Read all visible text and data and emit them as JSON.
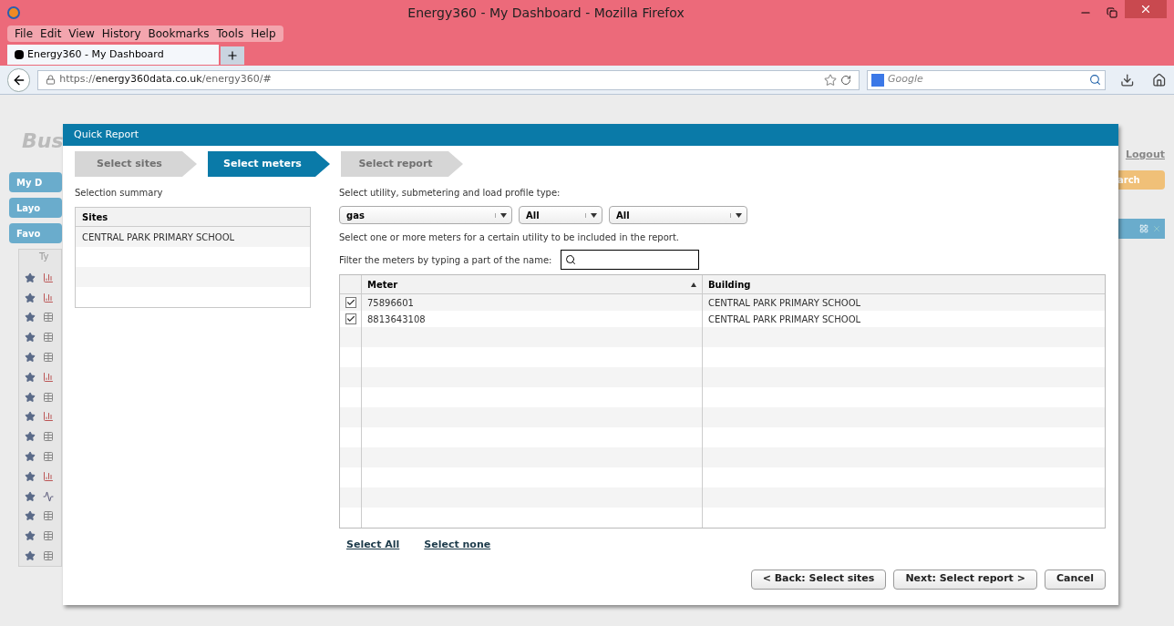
{
  "window": {
    "title": "Energy360 - My Dashboard - Mozilla Firefox"
  },
  "menu": [
    "File",
    "Edit",
    "View",
    "History",
    "Bookmarks",
    "Tools",
    "Help"
  ],
  "tabs": [
    {
      "label": "Energy360 - My Dashboard",
      "selected": true
    }
  ],
  "address": {
    "prefix": "https://",
    "domain": "energy360data.co.uk",
    "path": "/energy360/#"
  },
  "search": {
    "placeholder": "Google"
  },
  "background": {
    "logo": "Bus",
    "nav": [
      "My D",
      "Layo",
      "Favo"
    ],
    "column": "Ty",
    "logout": "Logout",
    "search_button": "arch",
    "rows": [
      {
        "kind": "bars"
      },
      {
        "kind": "bars"
      },
      {
        "kind": "table"
      },
      {
        "kind": "table"
      },
      {
        "kind": "table"
      },
      {
        "kind": "bars"
      },
      {
        "kind": "table"
      },
      {
        "kind": "bars"
      },
      {
        "kind": "table"
      },
      {
        "kind": "table"
      },
      {
        "kind": "bars"
      },
      {
        "kind": "line"
      },
      {
        "kind": "table"
      },
      {
        "kind": "table"
      },
      {
        "kind": "table"
      }
    ]
  },
  "dialog": {
    "title": "Quick Report",
    "steps": [
      {
        "label": "Select sites",
        "selected": false
      },
      {
        "label": "Select meters",
        "selected": true
      },
      {
        "label": "Select report",
        "selected": false
      }
    ],
    "summary": {
      "title": "Selection summary",
      "column": "Sites",
      "rows": [
        "CENTRAL PARK PRIMARY SCHOOL"
      ]
    },
    "prompt": "Select utility, submetering and load profile type:",
    "dropdowns": [
      "gas",
      "All",
      "All"
    ],
    "instruction": "Select one or more meters for a certain utility to be included in the report.",
    "filter": {
      "label": "Filter the meters by typing a part of the name:"
    },
    "table": {
      "columns": [
        "Meter",
        "Building"
      ],
      "rows": [
        {
          "meter": "75896601",
          "building": "CENTRAL PARK PRIMARY SCHOOL",
          "checked": true
        },
        {
          "meter": "8813643108",
          "building": "CENTRAL PARK PRIMARY SCHOOL",
          "checked": true
        }
      ]
    },
    "links": [
      "Select All",
      "Select none"
    ],
    "buttons": [
      "< Back: Select sites",
      "Next: Select report >",
      "Cancel"
    ]
  }
}
